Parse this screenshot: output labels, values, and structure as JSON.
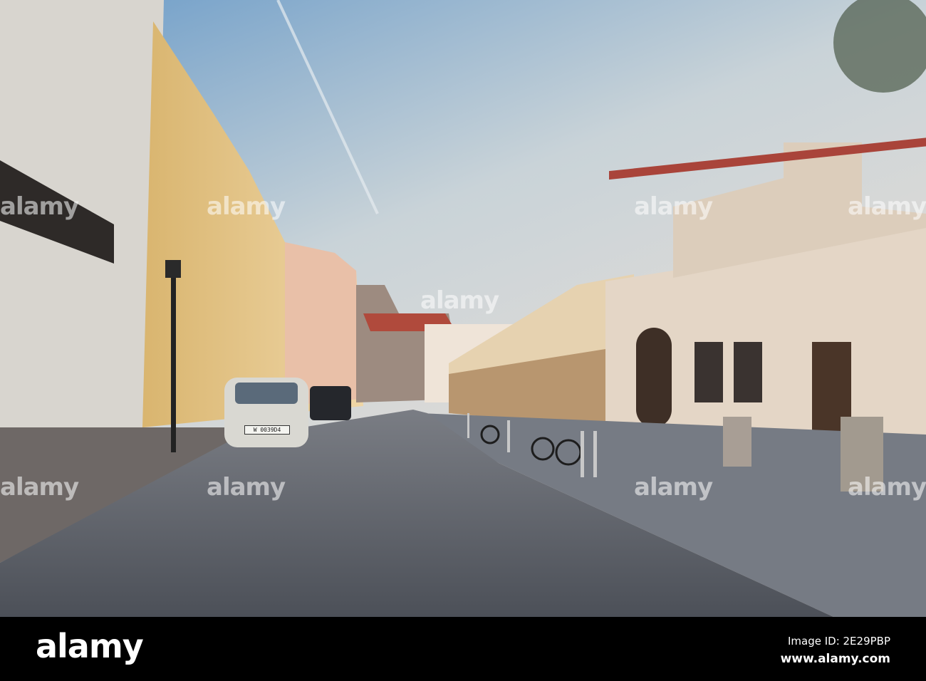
{
  "watermark": {
    "brand": "alamy"
  },
  "footer": {
    "logo": "alamy",
    "image_id": "Image ID: 2E29PBP",
    "url": "www.alamy.com"
  },
  "scene": {
    "license_plate": "W 0039D4",
    "colors": {
      "sky_top": "#6a9bc8",
      "sky_bottom": "#e8ddd3",
      "road": "#5d6168",
      "left_buildings": "#e9c98f",
      "right_building": "#e4d6c6"
    }
  }
}
